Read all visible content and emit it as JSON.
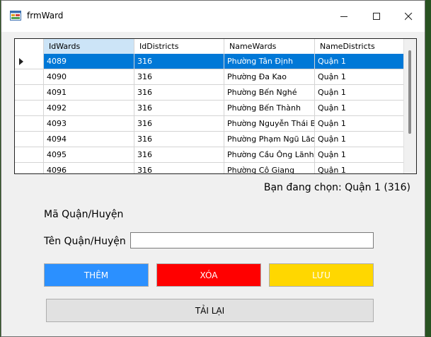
{
  "window": {
    "title": "frmWard"
  },
  "grid": {
    "columns": [
      "IdWards",
      "IdDistricts",
      "NameWards",
      "NameDistricts"
    ],
    "rows": [
      [
        "4089",
        "316",
        "Phường Tân Định",
        "Quận 1"
      ],
      [
        "4090",
        "316",
        "Phường Đa Kao",
        "Quận 1"
      ],
      [
        "4091",
        "316",
        "Phường Bến Nghé",
        "Quận 1"
      ],
      [
        "4092",
        "316",
        "Phường Bến Thành",
        "Quận 1"
      ],
      [
        "4093",
        "316",
        "Phường Nguyễn Thái B...",
        "Quận 1"
      ],
      [
        "4094",
        "316",
        "Phường Phạm Ngũ Lão",
        "Quận 1"
      ],
      [
        "4095",
        "316",
        "Phường Cầu Ông Lãnh",
        "Quận 1"
      ],
      [
        "4096",
        "316",
        "Phường Cô Giang",
        "Quận 1"
      ]
    ],
    "selected_row": 0
  },
  "status_text": "Bạn đang chọn: Quận 1 (316)",
  "form": {
    "ma_label": "Mã Quận/Huyện",
    "ten_label": "Tên Quận/Huyện",
    "ten_value": ""
  },
  "buttons": {
    "add": "THÊM",
    "delete": "XÓA",
    "save": "LƯU",
    "reload": "TẢI LẠI"
  },
  "colors": {
    "add_bg": "#2b90ff",
    "delete_bg": "#ff0000",
    "save_bg": "#ffd700",
    "reload_bg": "#e1e1e1",
    "selection": "#0078d7"
  }
}
